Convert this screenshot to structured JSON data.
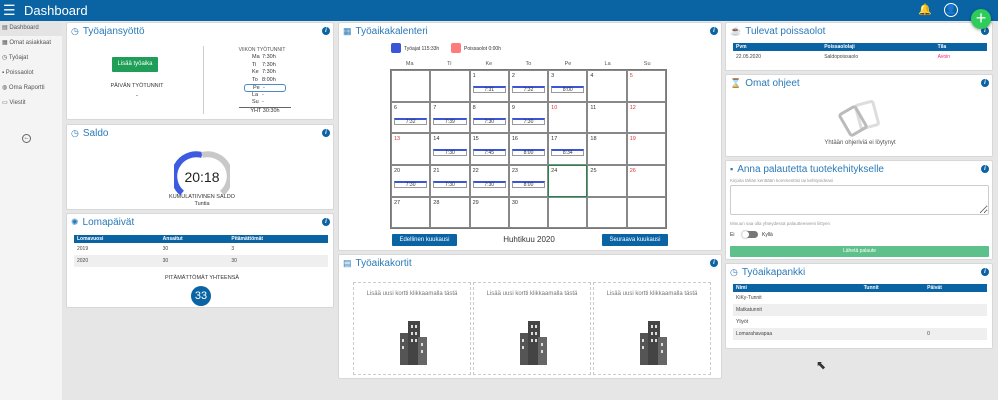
{
  "header": {
    "title": "Dashboard",
    "menu_icon": "hamburger-icon",
    "bell_icon": "bell-icon",
    "user_icon": "user-icon"
  },
  "fab": {
    "label": "+"
  },
  "sidebar": {
    "items": [
      {
        "label": "Dashboard",
        "icon": "dashboard-icon"
      },
      {
        "label": "Omat asiakkaat",
        "icon": "customers-icon"
      },
      {
        "label": "Työajat",
        "icon": "clock-icon"
      },
      {
        "label": "Poissaolot",
        "icon": "absence-icon"
      },
      {
        "label": "Oma Raportti",
        "icon": "report-icon"
      },
      {
        "label": "Viestit",
        "icon": "message-icon"
      }
    ],
    "collapse_icon": "arrow-left-circle-icon"
  },
  "tyoajansyotto": {
    "title": "Työajansyöttö",
    "add_button": "Lisää työaika",
    "day_label": "PÄIVÄN TYÖTUNNIT",
    "day_value": "-",
    "week_label": "VIIKON TYÖTUNNIT",
    "week": [
      {
        "day": "Ma",
        "value": "7:30h"
      },
      {
        "day": "Ti",
        "value": "7:30h"
      },
      {
        "day": "Ke",
        "value": "7:30h"
      },
      {
        "day": "To",
        "value": "8:00h"
      },
      {
        "day": "Pe",
        "value": "-"
      },
      {
        "day": "La",
        "value": "-"
      },
      {
        "day": "Su",
        "value": "-"
      }
    ],
    "total": "YHT 30:30h"
  },
  "saldo": {
    "title": "Saldo",
    "value": "20:18",
    "label": "KUMULATIIVINEN SALDO",
    "unit": "Tuntia",
    "gauge_fraction": 0.5
  },
  "lomapaivat": {
    "title": "Lomapäivät",
    "columns": [
      "Lomavuosi",
      "Ansaitut",
      "Pitämättömät"
    ],
    "rows": [
      [
        "2019",
        "30",
        "3"
      ],
      [
        "2020",
        "30",
        "30"
      ]
    ],
    "total_label": "PITÄMÄTTÖMÄT YHTEENSÄ",
    "total": "33"
  },
  "calendar": {
    "title": "Työaikakalenteri",
    "legend": [
      {
        "label": "Työajat 115:33h",
        "color": "#3a55d6"
      },
      {
        "label": "Poissaolot 0:00h",
        "color": "#ff7b7b"
      }
    ],
    "weekdays": [
      "Ma",
      "Ti",
      "Ke",
      "To",
      "Pe",
      "La",
      "Su"
    ],
    "month": "Huhtikuu 2020",
    "prev": "Edellinen kuukausi",
    "next": "Seuraava kuukausi",
    "offset": 2,
    "days": 30,
    "today": 24,
    "red_days": [
      5,
      10,
      12,
      13,
      19,
      26
    ],
    "entries": {
      "1": "7:31",
      "2": "7:32",
      "3": "8:00",
      "6": "7:32",
      "7": "7:39",
      "8": "7:30",
      "9": "7:30",
      "14": "7:30",
      "15": "7:45",
      "16": "8:00",
      "17": "8:34",
      "20": "7:30",
      "21": "7:30",
      "22": "7:30",
      "23": "8:00"
    }
  },
  "cards": {
    "title": "Työaikakortit",
    "placeholder": "Lisää uusi kortti klikkaamalla tästä"
  },
  "absences": {
    "title": "Tulevat poissaolot",
    "columns": [
      "Pvm",
      "Poissaololaji",
      "Tila"
    ],
    "rows": [
      [
        "22.05.2020",
        "Saldopoissaolo",
        "Avoin"
      ]
    ]
  },
  "guides": {
    "title": "Omat ohjeet",
    "empty": "Yhtään ohjeriviä ei löytynyt"
  },
  "feedback": {
    "title": "Anna palautetta tuotekehitykselle",
    "field_label": "Kirjoita tähän kenttään kommenttisi tai kehitysideasi",
    "contact_label": "Minuun saa olla yhteydessä palautteeseeni liittyen",
    "no": "Ei",
    "yes": "Kyllä",
    "send": "Lähetä palaute"
  },
  "bank": {
    "title": "Työaikapankki",
    "columns": [
      "Nimi",
      "Tunnit",
      "Päivät"
    ],
    "rows": [
      [
        "KiKy-Tunnit",
        "",
        ""
      ],
      [
        "Matkatunnit",
        "",
        ""
      ],
      [
        "Yliyöt",
        "",
        ""
      ],
      [
        "Lomarahavapaa",
        "",
        "0"
      ]
    ]
  }
}
